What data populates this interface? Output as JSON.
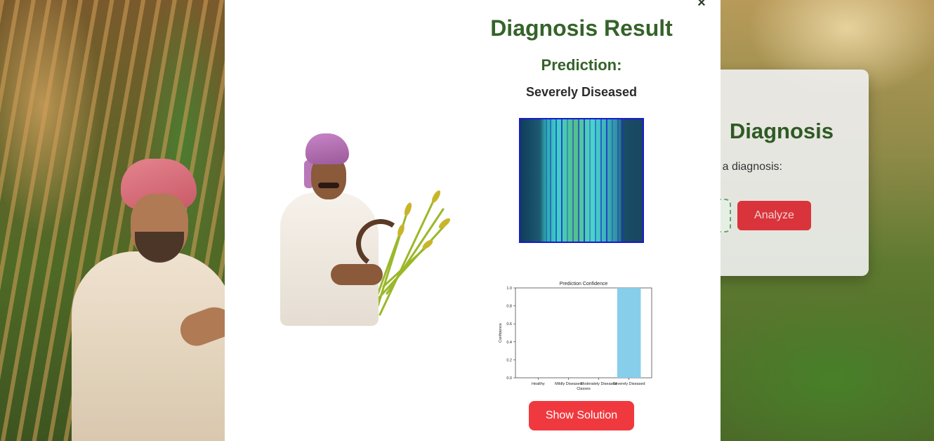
{
  "modal": {
    "close_symbol": "×",
    "title": "Diagnosis Result",
    "prediction_label": "Prediction:",
    "prediction_value": "Severely Diseased",
    "solution_button": "Show Solution"
  },
  "background_card": {
    "title": "Diagnosis",
    "subtitle": "a diagnosis:",
    "analyze_button": "Analyze"
  },
  "colors": {
    "title_green": "#35632a",
    "button_red": "#f0393f",
    "bar_blue": "#87ceeb"
  },
  "chart_data": {
    "type": "bar",
    "title": "Prediction Confidence",
    "xlabel": "Classes",
    "ylabel": "Confidence",
    "categories": [
      "Healthy",
      "Mildly Diseased",
      "Moderately Diseased",
      "Severely Diseased"
    ],
    "values": [
      0.0,
      0.0,
      0.0,
      1.0
    ],
    "ylim": [
      0,
      1.0
    ],
    "yticks": [
      "0.0",
      "0.2",
      "0.4",
      "0.6",
      "0.8",
      "1.0"
    ],
    "color": "#87ceeb"
  }
}
